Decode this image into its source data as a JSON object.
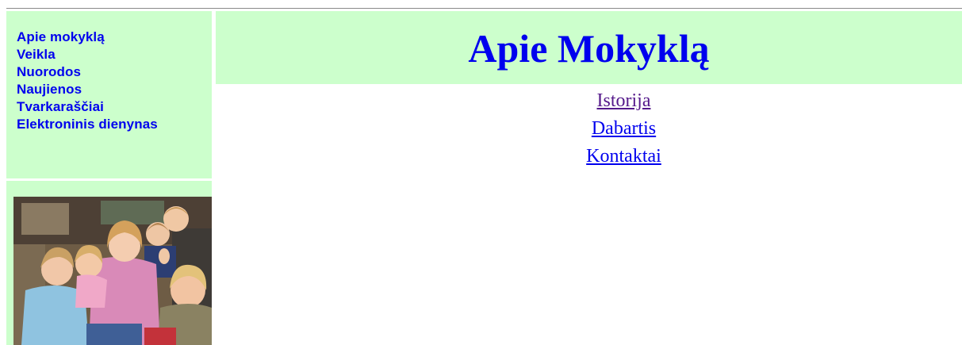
{
  "page": {
    "title": "Apie Mokyklą",
    "colors": {
      "panel_background": "#ccffcc",
      "link": "#0000ee",
      "visited_link": "#551a8b",
      "rule": "#8a8a8a"
    }
  },
  "sidebar": {
    "menu": [
      {
        "label": "Apie mokyklą"
      },
      {
        "label": "Veikla"
      },
      {
        "label": "Nuorodos"
      },
      {
        "label": "Naujienos"
      },
      {
        "label": "Tvarkaraščiai"
      },
      {
        "label": "Elektroninis dienynas"
      }
    ],
    "photo": {
      "subject": "group-of-smiling-children-photo"
    }
  },
  "main": {
    "links": [
      {
        "label": "Istorija",
        "visited": true
      },
      {
        "label": "Dabartis",
        "visited": false
      },
      {
        "label": "Kontaktai",
        "visited": false
      }
    ]
  }
}
